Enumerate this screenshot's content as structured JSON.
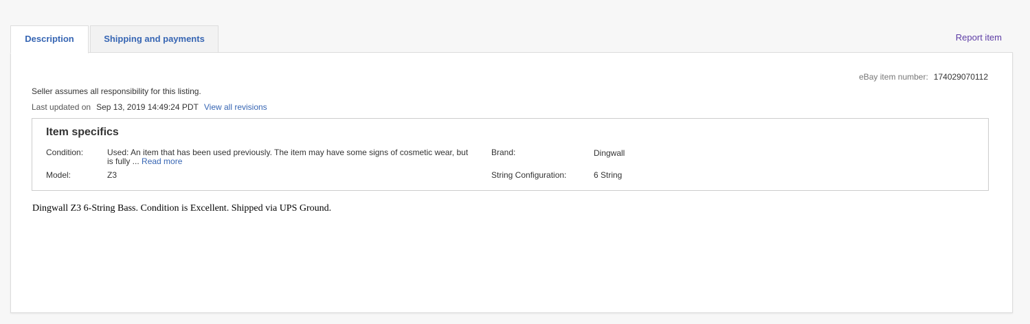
{
  "tabs": [
    {
      "label": "Description",
      "active": true
    },
    {
      "label": "Shipping and payments",
      "active": false
    }
  ],
  "report_item": "Report item",
  "item_number": {
    "label": "eBay item number:",
    "value": "174029070112"
  },
  "responsibility_text": "Seller assumes all responsibility for this listing.",
  "last_updated": {
    "label": "Last updated on",
    "date": "Sep 13, 2019 14:49:24 PDT",
    "revisions_link": "View all revisions"
  },
  "item_specifics": {
    "title": "Item specifics",
    "condition": {
      "label": "Condition:",
      "value": "Used: An item that has been used previously. The item may have some signs of cosmetic wear, but is fully ...",
      "read_more": "Read more"
    },
    "brand": {
      "label": "Brand:",
      "value": "Dingwall"
    },
    "model": {
      "label": "Model:",
      "value": "Z3"
    },
    "string_configuration": {
      "label": "String Configuration:",
      "value": "6 String"
    }
  },
  "description_text": "Dingwall Z3 6-String Bass. Condition is Excellent. Shipped via UPS Ground.",
  "colors": {
    "link": "#3665b3",
    "visited_link": "#5c3ca5",
    "border": "#cccccc",
    "background": "#f7f7f7"
  }
}
